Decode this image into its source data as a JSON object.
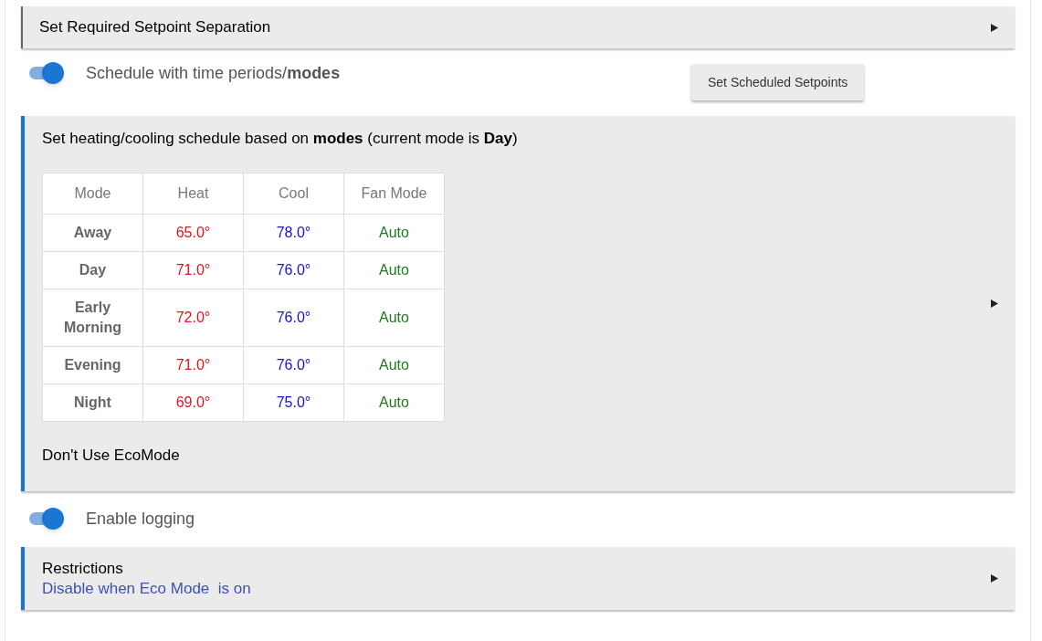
{
  "separation_panel": {
    "title": "Set Required Setpoint Separation",
    "expanded": false
  },
  "schedule_toggle": {
    "label": "Schedule with time periods/**modes**",
    "on": true
  },
  "set_setpoints_button": "Set Scheduled Setpoints",
  "schedule_panel": {
    "title": "Set heating/cooling schedule based on **modes** (current mode is **Day**)",
    "expanded": false,
    "table": {
      "columns": [
        "Mode",
        "Heat",
        "Cool",
        "Fan Mode"
      ],
      "rows": [
        [
          "Away",
          "65.0°",
          "78.0°",
          "Auto"
        ],
        [
          "Day",
          "71.0°",
          "76.0°",
          "Auto"
        ],
        [
          "Early Morning",
          "72.0°",
          "76.0°",
          "Auto"
        ],
        [
          "Evening",
          "71.0°",
          "76.0°",
          "Auto"
        ],
        [
          "Night",
          "69.0°",
          "75.0°",
          "Auto"
        ]
      ]
    },
    "note": "Don't Use EcoMode"
  },
  "logging_toggle": {
    "label": "Enable logging",
    "on": true
  },
  "restrictions_panel": {
    "title": "Restrictions",
    "subtitle": "Disable when Eco Mode  is on",
    "expanded": false
  }
}
